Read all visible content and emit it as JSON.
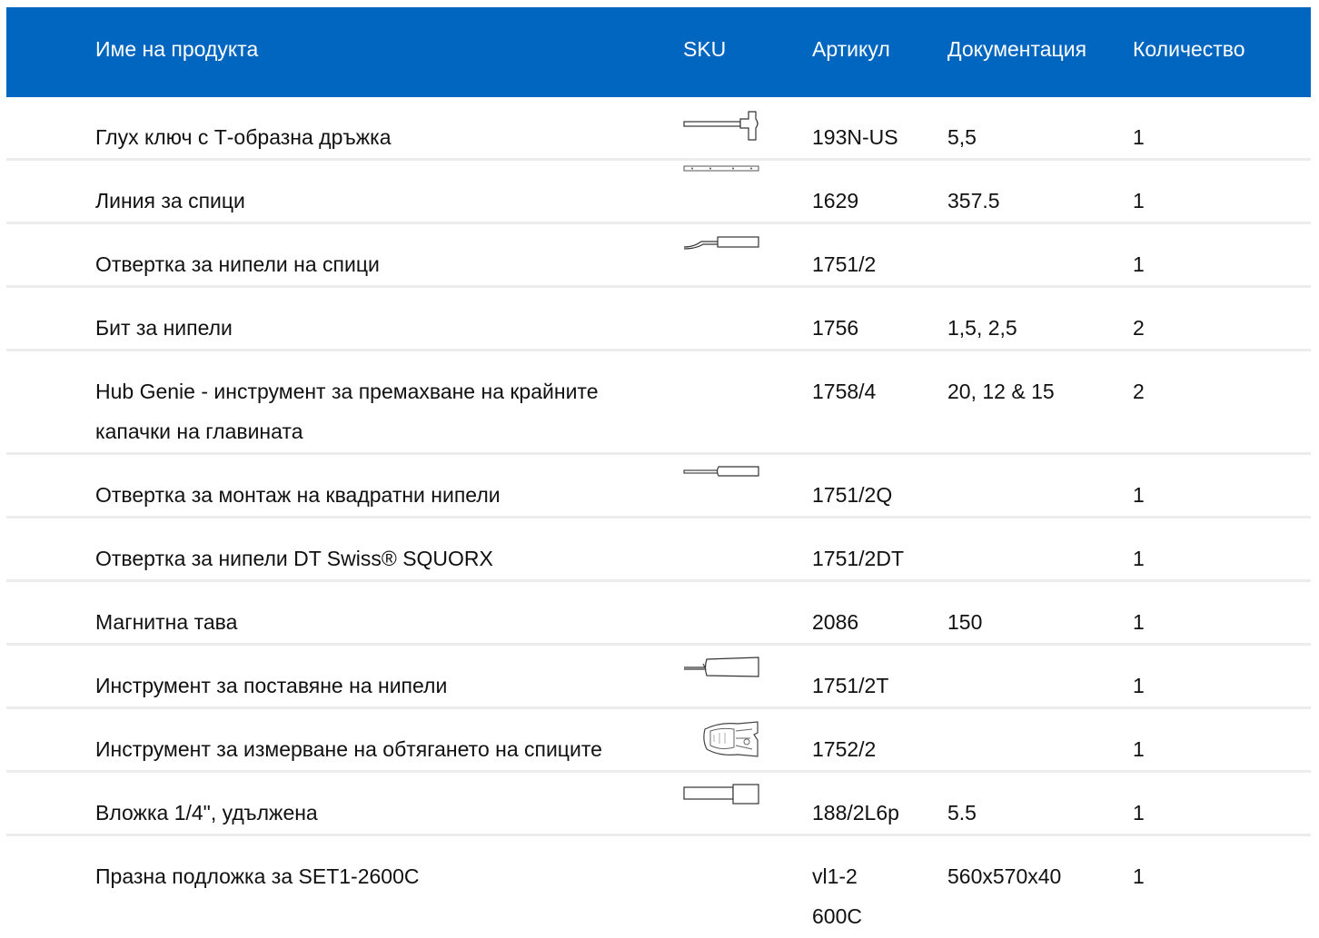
{
  "header": {
    "name": "Име на продукта",
    "sku": "SKU",
    "article": "Артикул",
    "documentation": "Документация",
    "quantity": "Количество"
  },
  "rows": [
    {
      "name": "Глух ключ с Т-образна дръжка",
      "sku_icon": "t-handle-wrench-icon",
      "article": "193N-US",
      "doc": "5,5",
      "qty": "1"
    },
    {
      "name": "Линия за спици",
      "sku_icon": "spoke-ruler-icon",
      "article": "1629",
      "doc": "357.5",
      "qty": "1"
    },
    {
      "name": "Отвертка за нипели на спици",
      "sku_icon": "nipple-screwdriver-icon",
      "article": "1751/2",
      "doc": "",
      "qty": "1"
    },
    {
      "name": "Бит за нипели",
      "sku_icon": "",
      "article": "1756",
      "doc": "1,5, 2,5",
      "qty": "2"
    },
    {
      "name": "Hub Genie - инструмент за премахване на крайните капачки на главината",
      "sku_icon": "",
      "article": "1758/4",
      "doc": "20, 12 & 15",
      "qty": "2"
    },
    {
      "name": "Отвертка за монтаж на квадратни нипели",
      "sku_icon": "square-nipple-driver-icon",
      "article": "1751/2Q",
      "doc": "",
      "qty": "1"
    },
    {
      "name": "Отвертка за нипели DT Swiss® SQUORX",
      "sku_icon": "",
      "article": "1751/2DT",
      "doc": "",
      "qty": "1"
    },
    {
      "name": "Магнитна тава",
      "sku_icon": "",
      "article": "2086",
      "doc": "150",
      "qty": "1"
    },
    {
      "name": "Инструмент за поставяне на нипели",
      "sku_icon": "nipple-insertion-tool-icon",
      "article": "1751/2T",
      "doc": "",
      "qty": "1"
    },
    {
      "name": "Инструмент за измерване на обтягането на спиците",
      "sku_icon": "tension-meter-icon",
      "article": "1752/2",
      "doc": "",
      "qty": "1"
    },
    {
      "name": "Вложка 1/4\", удължена",
      "sku_icon": "socket-bit-icon",
      "article": "188/2L6p",
      "doc": "5.5",
      "qty": "1"
    },
    {
      "name": "Празна подложка за SET1-2600C",
      "sku_icon": "",
      "article": "vl1-2600C",
      "doc": "560x570x40",
      "qty": "1"
    }
  ]
}
